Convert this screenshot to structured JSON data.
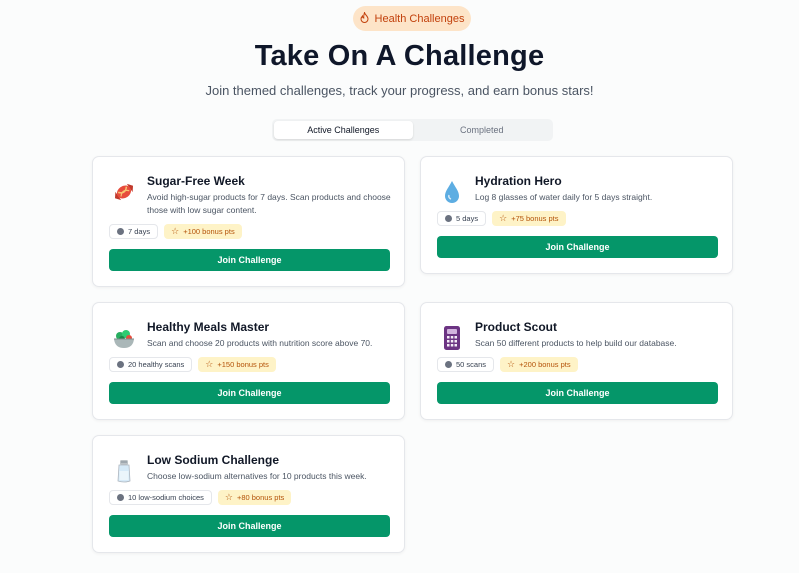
{
  "header": {
    "badge_label": "Health Challenges",
    "title": "Take On A Challenge",
    "subtitle": "Join themed challenges, track your progress, and earn bonus stars!"
  },
  "tabs": [
    {
      "label": "Active Challenges",
      "active": true
    },
    {
      "label": "Completed",
      "active": false
    }
  ],
  "challenges": [
    {
      "title": "Sugar-Free Week",
      "description": "Avoid high-sugar products for 7 days. Scan products and choose those with low sugar content.",
      "icon": "candy-icon",
      "duration": "7 days",
      "bonus": "+100 bonus pts",
      "button": "Join Challenge"
    },
    {
      "title": "Hydration Hero",
      "description": "Log 8 glasses of water daily for 5 days straight.",
      "icon": "water-drop-icon",
      "duration": "5 days",
      "bonus": "+75 bonus pts",
      "button": "Join Challenge"
    },
    {
      "title": "Healthy Meals Master",
      "description": "Scan and choose 20 products with nutrition score above 70.",
      "icon": "salad-icon",
      "duration": "20 healthy scans",
      "bonus": "+150 bonus pts",
      "button": "Join Challenge"
    },
    {
      "title": "Product Scout",
      "description": "Scan 50 different products to help build our database.",
      "icon": "calculator-icon",
      "duration": "50 scans",
      "bonus": "+200 bonus pts",
      "button": "Join Challenge"
    },
    {
      "title": "Low Sodium Challenge",
      "description": "Choose low-sodium alternatives for 10 products this week.",
      "icon": "salt-shaker-icon",
      "duration": "10 low-sodium choices",
      "bonus": "+80 bonus pts",
      "button": "Join Challenge"
    }
  ]
}
